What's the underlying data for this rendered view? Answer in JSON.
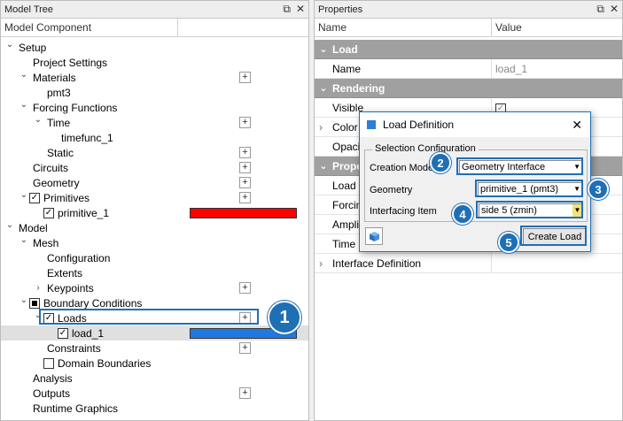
{
  "model_tree": {
    "title": "Model Tree",
    "column": "Model Component",
    "items": [
      {
        "label": "Setup",
        "level": 0,
        "arrow": "v"
      },
      {
        "label": "Project Settings",
        "level": 1
      },
      {
        "label": "Materials",
        "level": 1,
        "arrow": "v",
        "plus": true
      },
      {
        "label": "pmt3",
        "level": 2
      },
      {
        "label": "Forcing Functions",
        "level": 1,
        "arrow": "v"
      },
      {
        "label": "Time",
        "level": 2,
        "arrow": "v",
        "plus": true
      },
      {
        "label": "timefunc_1",
        "level": 3
      },
      {
        "label": "Static",
        "level": 2,
        "plus": true
      },
      {
        "label": "Circuits",
        "level": 1,
        "plus": true
      },
      {
        "label": "Geometry",
        "level": 1,
        "plus": true
      },
      {
        "label": "Primitives",
        "level": 1,
        "arrow": "v",
        "checkbox": "checked",
        "plus": true
      },
      {
        "label": "primitive_1",
        "level": 2,
        "checkbox": "checked",
        "swatch": "#ff0000"
      },
      {
        "label": "Model",
        "level": 0,
        "arrow": "v"
      },
      {
        "label": "Mesh",
        "level": 1,
        "arrow": "v"
      },
      {
        "label": "Configuration",
        "level": 2
      },
      {
        "label": "Extents",
        "level": 2
      },
      {
        "label": "Keypoints",
        "level": 2,
        "arrow": ">",
        "plus": true
      },
      {
        "label": "Boundary Conditions",
        "level": 1,
        "arrow": "v",
        "checkbox": "filled"
      },
      {
        "label": "Loads",
        "level": 2,
        "arrow": "v",
        "checkbox": "checked",
        "plus": true
      },
      {
        "label": "load_1",
        "level": 3,
        "checkbox": "checked",
        "swatch": "#1e7ae0",
        "selected": true
      },
      {
        "label": "Constraints",
        "level": 2,
        "plus": true
      },
      {
        "label": "Domain Boundaries",
        "level": 2,
        "checkbox": "unchecked"
      },
      {
        "label": "Analysis",
        "level": 1
      },
      {
        "label": "Outputs",
        "level": 1,
        "plus": true
      },
      {
        "label": "Runtime Graphics",
        "level": 1
      }
    ]
  },
  "properties": {
    "title": "Properties",
    "col_name": "Name",
    "col_value": "Value",
    "rows": [
      {
        "type": "section",
        "label": "Load"
      },
      {
        "type": "prop",
        "label": "Name",
        "value": "load_1"
      },
      {
        "type": "section",
        "label": "Rendering"
      },
      {
        "type": "prop",
        "label": "Visible",
        "value": "",
        "checkbox": true
      },
      {
        "type": "prop",
        "label": "Color",
        "arrow": ">"
      },
      {
        "type": "prop",
        "label": "Opacity"
      },
      {
        "type": "section",
        "label": "Properties"
      },
      {
        "type": "prop",
        "label": "Load Type"
      },
      {
        "type": "prop",
        "label": "Forcing Function"
      },
      {
        "type": "prop",
        "label": "Amplitude"
      },
      {
        "type": "prop",
        "label": "Time Shift"
      },
      {
        "type": "prop",
        "label": "Interface Definition",
        "arrow": ">"
      }
    ]
  },
  "dialog": {
    "title": "Load Definition",
    "group": "Selection Configuration",
    "creation_mode_label": "Creation Mode",
    "creation_mode_value": "Geometry Interface",
    "geometry_label": "Geometry",
    "geometry_value": "primitive_1 (pmt3)",
    "interfacing_label": "Interfacing Item",
    "interfacing_value": "side 5 (zmin)",
    "create_button": "Create Load"
  },
  "callouts": [
    "1",
    "2",
    "3",
    "4",
    "5"
  ],
  "colors": {
    "accent": "#1f6fb5",
    "primitive": "#ff0000",
    "load": "#1e7ae0"
  }
}
